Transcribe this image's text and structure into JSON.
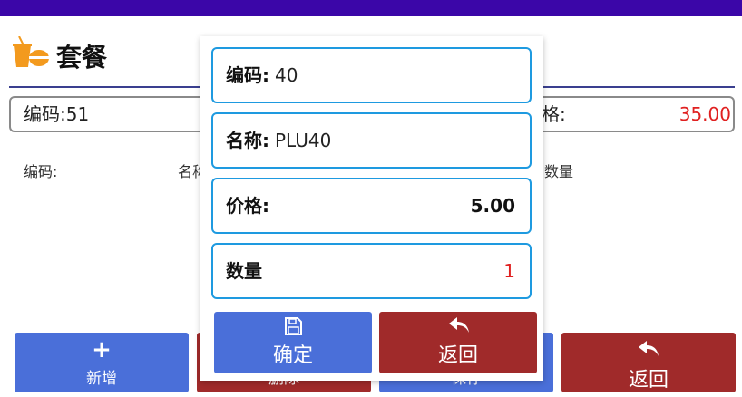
{
  "colors": {
    "statusbar": "#3b06a8",
    "primary_button": "#4a6fd9",
    "danger_button": "#a02a2a",
    "field_border": "#1e9ae0",
    "price_text": "#e02020"
  },
  "header": {
    "title": "套餐",
    "icon": "drink-burger-icon"
  },
  "background_form": {
    "code_value": "编码:51",
    "price_label": "格:",
    "price_value": "35.00",
    "columns": [
      "编码:",
      "名称",
      "数量"
    ]
  },
  "bottom_bar": {
    "add_label": "新增",
    "delete_label": "删除",
    "save_label": "保存",
    "back_label": "返回"
  },
  "dialog": {
    "code_label": "编码:",
    "code_value": "40",
    "name_label": "名称:",
    "name_value": "PLU40",
    "price_label": "价格:",
    "price_value": "5.00",
    "qty_label": "数量",
    "qty_value": "1",
    "confirm_label": "确定",
    "back_label": "返回"
  }
}
